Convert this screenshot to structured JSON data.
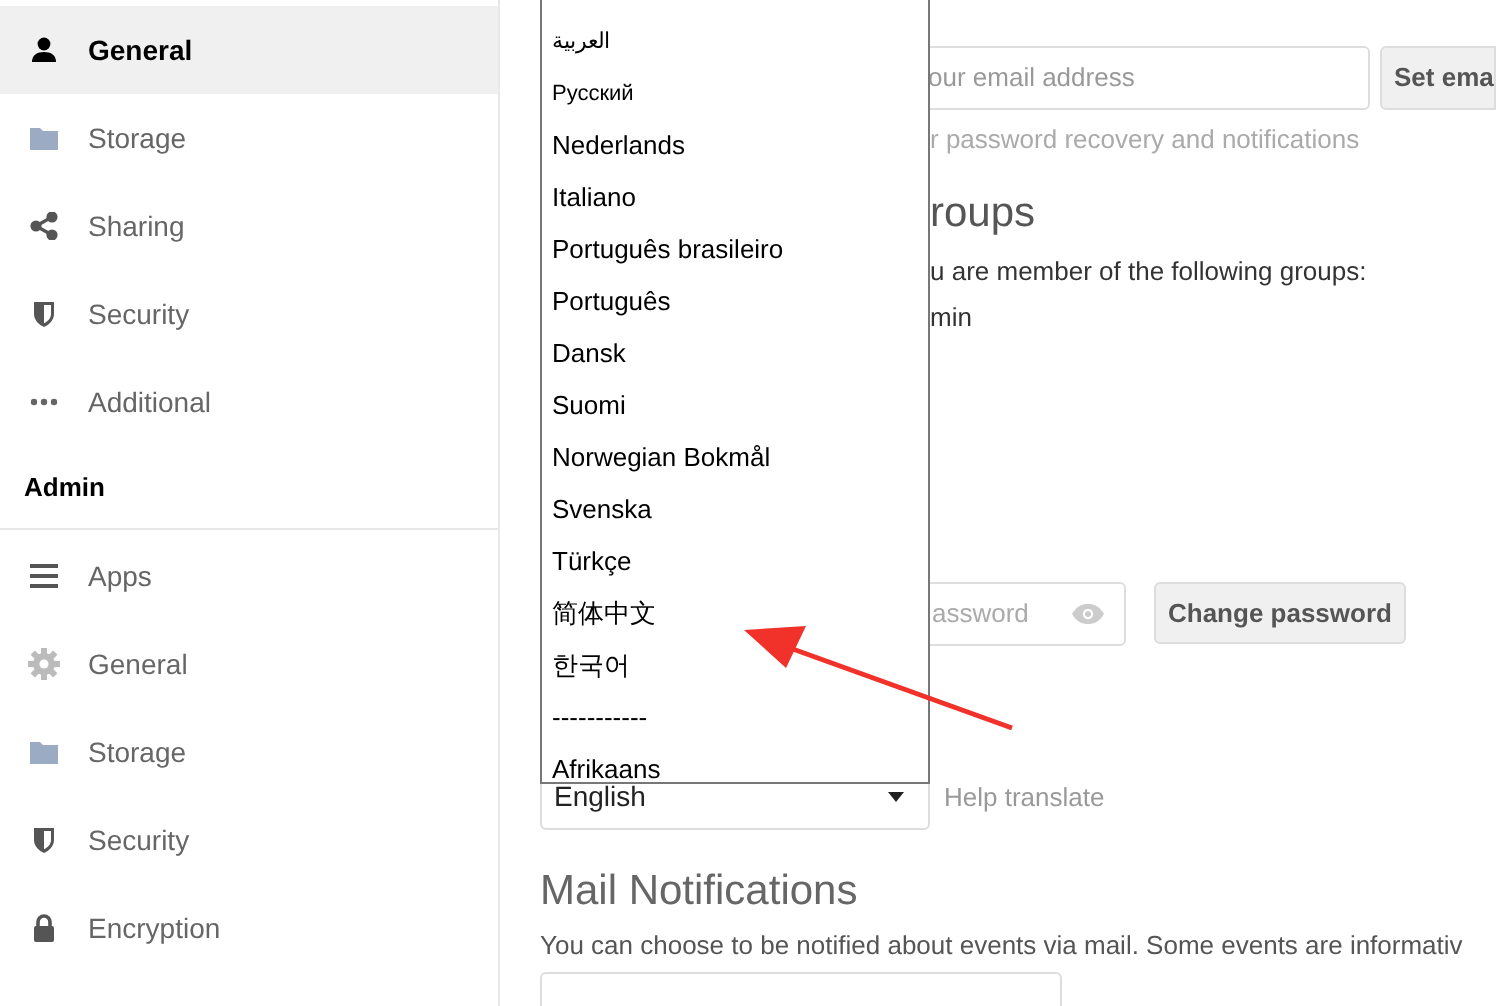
{
  "sidebar": {
    "personal_items": [
      {
        "label": "General",
        "selected": true
      },
      {
        "label": "Storage",
        "selected": false
      },
      {
        "label": "Sharing",
        "selected": false
      },
      {
        "label": "Security",
        "selected": false
      },
      {
        "label": "Additional",
        "selected": false
      }
    ],
    "admin_header": "Admin",
    "admin_items": [
      {
        "label": "Apps",
        "selected": false
      },
      {
        "label": "General",
        "selected": false
      },
      {
        "label": "Storage",
        "selected": false
      },
      {
        "label": "Security",
        "selected": false
      },
      {
        "label": "Encryption",
        "selected": false
      }
    ]
  },
  "email": {
    "placeholder": "our email address",
    "button": "Set ema",
    "hint": "r password recovery and notifications"
  },
  "groups": {
    "heading": "roups",
    "text": "u are member of the following groups:",
    "groups": [
      "min"
    ]
  },
  "password": {
    "placeholder": "assword",
    "button": "Change password"
  },
  "language": {
    "value": "English",
    "help_link": "Help translate",
    "options": [
      {
        "label": "العربية",
        "kind": "small"
      },
      {
        "label": "Русский",
        "kind": "small"
      },
      {
        "label": "Nederlands",
        "kind": "normal"
      },
      {
        "label": "Italiano",
        "kind": "normal"
      },
      {
        "label": "Português brasileiro",
        "kind": "normal"
      },
      {
        "label": "Português",
        "kind": "normal"
      },
      {
        "label": "Dansk",
        "kind": "normal"
      },
      {
        "label": "Suomi",
        "kind": "normal"
      },
      {
        "label": "Norwegian Bokmål",
        "kind": "normal"
      },
      {
        "label": "Svenska",
        "kind": "normal"
      },
      {
        "label": "Türkçe",
        "kind": "normal"
      },
      {
        "label": "简体中文",
        "kind": "normal"
      },
      {
        "label": "한국어",
        "kind": "normal"
      },
      {
        "label": "-----------",
        "kind": "normal"
      },
      {
        "label": "Afrikaans",
        "kind": "normal"
      }
    ]
  },
  "mail_notifications": {
    "heading": "Mail Notifications",
    "text": "You can choose to be notified about events via mail. Some events are informativ"
  }
}
